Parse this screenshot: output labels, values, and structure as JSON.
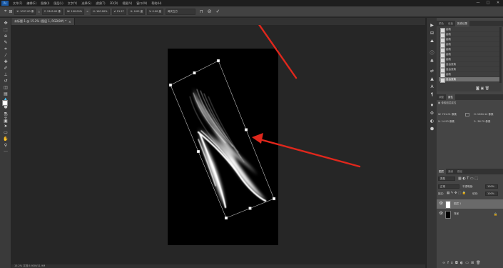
{
  "app": {
    "logo": "Ps",
    "menu": [
      "文件(F)",
      "编辑(E)",
      "图像(I)",
      "图层(L)",
      "文字(Y)",
      "选择(S)",
      "滤镜(T)",
      "3D(D)",
      "视图(V)",
      "窗口(W)",
      "帮助(H)"
    ],
    "window_controls": [
      "—",
      "□",
      "✕"
    ]
  },
  "options": {
    "x": "X: 1037.00 像",
    "y": "Y: 1345.00 像",
    "w": "W: 100.00%",
    "h": "H: 100.00%",
    "angle": "∠ 21.27",
    "hskew": "H: 0.00 度",
    "vskew": "V: 0.00 度",
    "interp": "两次立方",
    "cancel_icon": "cancel-icon",
    "commit_icon": "commit-icon"
  },
  "document": {
    "tab_label": "未标题-1 @ 15.2% (图层 1, RGB/8#) *"
  },
  "status": {
    "text": "15.2%    文档:5.93M/11.9M"
  },
  "history_panel": {
    "tabs": [
      "颜色",
      "色板",
      "历史记录"
    ],
    "items": [
      "画笔",
      "画笔",
      "画笔",
      "画笔",
      "画笔",
      "画笔",
      "画笔",
      "自由变换",
      "自由变换",
      "画笔",
      "自由变换"
    ],
    "selected_index": 10
  },
  "properties_panel": {
    "tabs": [
      "调整",
      "属性"
    ],
    "section": "像素图层属性",
    "w_value": "W: 701.01 像素",
    "h_value": "H: 1064.14 像素",
    "x_value": "X: 14.93 像素",
    "y_value": "Y: -36.79 像素"
  },
  "layers_panel": {
    "tabs": [
      "图层",
      "通道",
      "路径"
    ],
    "kind_label": "类型",
    "blend_mode": "正常",
    "opacity_label": "不透明度:",
    "opacity_value": "100%",
    "lock_label": "锁定:",
    "fill_label": "填充:",
    "fill_value": "100%",
    "layers": [
      {
        "name": "图层 1",
        "thumb_color": "#ffffff",
        "selected": true
      },
      {
        "name": "背景",
        "thumb_color": "#000000",
        "selected": false
      }
    ]
  }
}
